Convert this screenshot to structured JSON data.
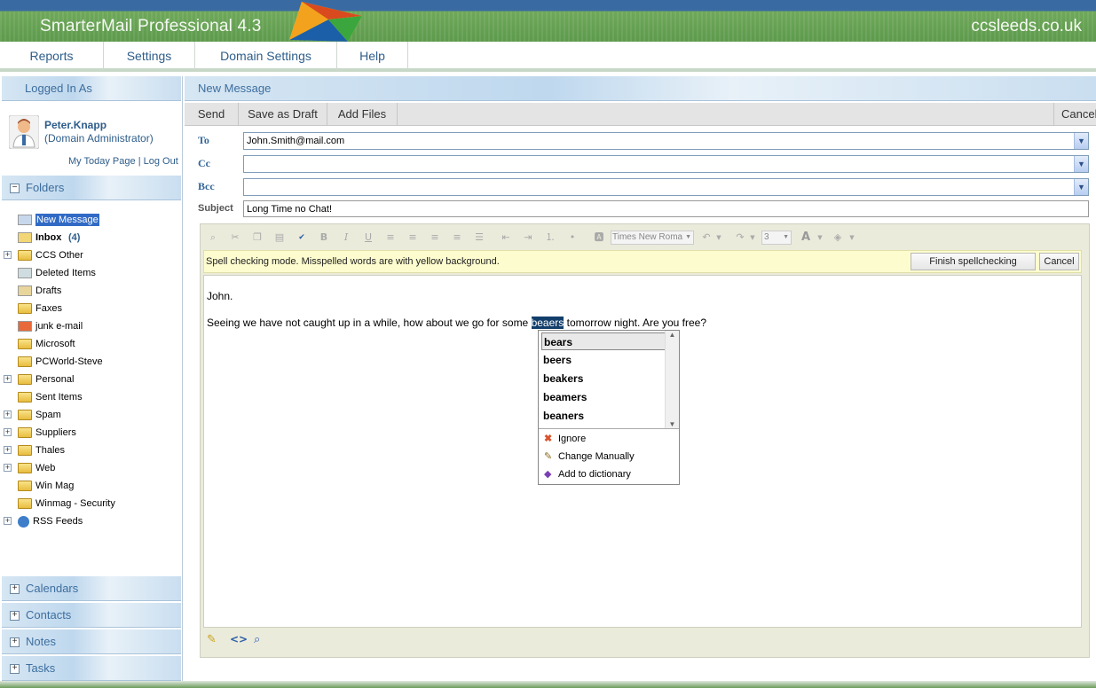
{
  "header": {
    "app_title": "SmarterMail Professional 4.3",
    "site_name": "ccsleeds.co.uk"
  },
  "nav": {
    "items": [
      "Reports",
      "Settings",
      "Domain Settings",
      "Help"
    ]
  },
  "sidebar": {
    "logged_in_title": "Logged In As",
    "user_name": "Peter.Knapp",
    "user_role": "(Domain Administrator)",
    "links": {
      "today": "My Today Page",
      "sep": "|",
      "logout": "Log Out"
    },
    "folders_title": "Folders",
    "folders": [
      {
        "label": "New Message",
        "icon": "compose-icon",
        "expand": false,
        "selected": true
      },
      {
        "label": "Inbox",
        "count": "(4)",
        "icon": "inbox-icon",
        "expand": false,
        "bold": true
      },
      {
        "label": "CCS Other",
        "icon": "folder-icon",
        "expand": true
      },
      {
        "label": "Deleted Items",
        "icon": "trash-icon",
        "expand": false
      },
      {
        "label": "Drafts",
        "icon": "drafts-icon",
        "expand": false
      },
      {
        "label": "Faxes",
        "icon": "folder-icon",
        "expand": false
      },
      {
        "label": "junk e-mail",
        "icon": "junk-icon",
        "expand": false
      },
      {
        "label": "Microsoft",
        "icon": "folder-icon",
        "expand": false
      },
      {
        "label": "PCWorld-Steve",
        "icon": "folder-icon",
        "expand": false
      },
      {
        "label": "Personal",
        "icon": "folder-icon",
        "expand": true
      },
      {
        "label": "Sent Items",
        "icon": "folder-icon",
        "expand": false
      },
      {
        "label": "Spam",
        "icon": "folder-icon",
        "expand": true
      },
      {
        "label": "Suppliers",
        "icon": "folder-icon",
        "expand": true
      },
      {
        "label": "Thales",
        "icon": "folder-icon",
        "expand": true
      },
      {
        "label": "Web",
        "icon": "folder-icon",
        "expand": true
      },
      {
        "label": "Win Mag",
        "icon": "folder-icon",
        "expand": false
      },
      {
        "label": "Winmag - Security",
        "icon": "folder-icon",
        "expand": false
      },
      {
        "label": "RSS Feeds",
        "icon": "globe-icon",
        "expand": true
      }
    ],
    "sections": [
      "Calendars",
      "Contacts",
      "Notes",
      "Tasks"
    ]
  },
  "compose": {
    "title": "New Message",
    "toolbar": {
      "send": "Send",
      "save_draft": "Save as Draft",
      "add_files": "Add Files",
      "cancel": "Cancel"
    },
    "labels": {
      "to": "To",
      "cc": "Cc",
      "bcc": "Bcc",
      "subject": "Subject"
    },
    "to": "John.Smith@mail.com",
    "cc": "",
    "bcc": "",
    "subject": "Long Time no Chat!",
    "font_name": "Times New Roma",
    "font_size": "3",
    "spell_msg": "Spell checking mode. Misspelled words are with yellow background.",
    "finish_spell": "Finish spellchecking",
    "spell_cancel": "Cancel",
    "body_greeting": "John.",
    "body_before": "Seeing we have not caught up in a while, how about we go for some ",
    "misspelled": "beaers",
    "body_after": " tomorrow night. Are you free?"
  },
  "spell_popup": {
    "suggestions": [
      "bears",
      "beers",
      "beakers",
      "beamers",
      "beaners"
    ],
    "actions": {
      "ignore": "Ignore",
      "change": "Change Manually",
      "add": "Add to dictionary"
    }
  },
  "colors": {
    "accent": "#2e5d8a",
    "banner_green": "#5d9a4c",
    "banner_blue": "#3a6aa2",
    "highlight": "#123e6b",
    "spellbar": "#fdfccf"
  }
}
